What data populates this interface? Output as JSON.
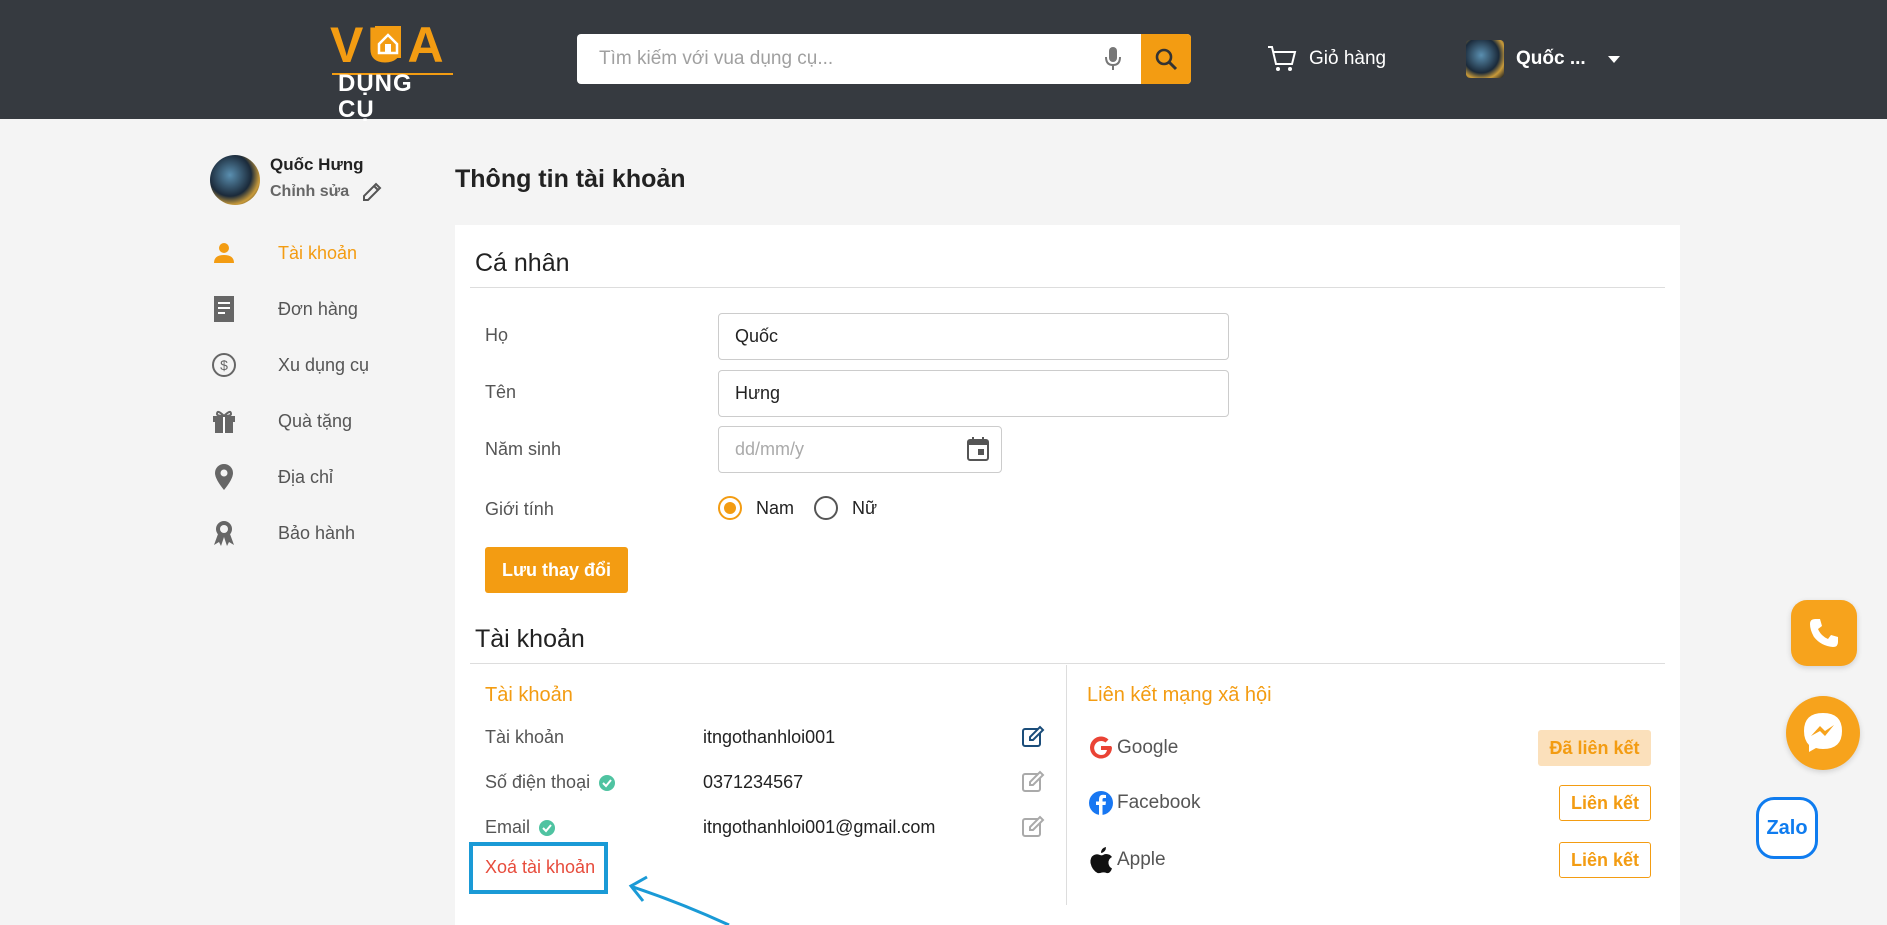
{
  "header": {
    "logo_top": "VUA",
    "logo_bottom": "DỤNG CỤ",
    "search_placeholder": "Tìm kiếm với vua dụng cụ...",
    "cart_label": "Giỏ hàng",
    "user_name": "Quốc ..."
  },
  "sidebar": {
    "profile_name": "Quốc Hưng",
    "edit_label": "Chỉnh sửa",
    "items": [
      {
        "label": "Tài khoản",
        "icon": "person-icon",
        "active": true
      },
      {
        "label": "Đơn hàng",
        "icon": "document-icon",
        "active": false
      },
      {
        "label": "Xu dụng cụ",
        "icon": "coin-icon",
        "active": false
      },
      {
        "label": "Quà tặng",
        "icon": "gift-icon",
        "active": false
      },
      {
        "label": "Địa chỉ",
        "icon": "location-pin-icon",
        "active": false
      },
      {
        "label": "Bảo hành",
        "icon": "award-badge-icon",
        "active": false
      }
    ]
  },
  "main": {
    "page_title": "Thông tin tài khoản",
    "personal": {
      "title": "Cá nhân",
      "last_name_label": "Họ",
      "last_name_value": "Quốc",
      "first_name_label": "Tên",
      "first_name_value": "Hưng",
      "birth_label": "Năm sinh",
      "birth_placeholder": "dd/mm/y",
      "gender_label": "Giới tính",
      "gender_options": [
        "Nam",
        "Nữ"
      ],
      "gender_selected": "Nam",
      "save_label": "Lưu thay đổi"
    },
    "account": {
      "title": "Tài khoản",
      "subtitle": "Tài khoản",
      "rows": [
        {
          "label": "Tài khoản",
          "value": "itngothanhloi001",
          "verified": false
        },
        {
          "label": "Số điện thoại",
          "value": "0371234567",
          "verified": true
        },
        {
          "label": "Email",
          "value": "itngothanhloi001@gmail.com",
          "verified": true
        }
      ],
      "delete_label": "Xoá tài khoản"
    },
    "social": {
      "title": "Liên kết mạng xã hội",
      "items": [
        {
          "name": "Google",
          "status": "Đã liên kết"
        },
        {
          "name": "Facebook",
          "status": "Liên kết"
        },
        {
          "name": "Apple",
          "status": "Liên kết"
        }
      ]
    }
  },
  "floating": {
    "zalo_label": "Zalo"
  },
  "colors": {
    "accent": "#f39c12",
    "header_bg": "#363a40",
    "danger": "#e74c3c",
    "highlight_box": "#1a9ad6"
  }
}
